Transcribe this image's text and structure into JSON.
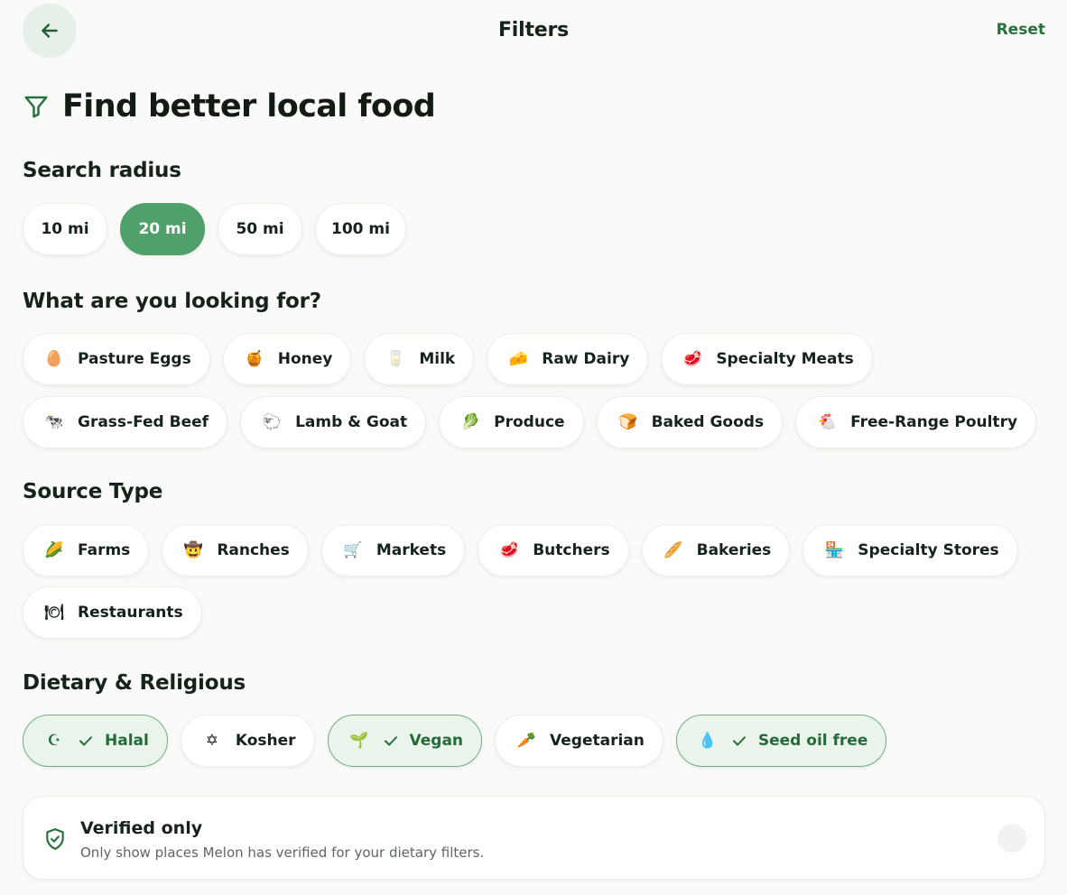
{
  "header": {
    "title": "Filters",
    "reset_label": "Reset"
  },
  "hero": {
    "title": "Find better local food"
  },
  "radius": {
    "title": "Search radius",
    "options": [
      "10 mi",
      "20 mi",
      "50 mi",
      "100 mi"
    ],
    "selected": "20 mi"
  },
  "looking": {
    "title": "What are you looking for?",
    "items": [
      {
        "emoji": "🥚",
        "label": "Pasture Eggs"
      },
      {
        "emoji": "🍯",
        "label": "Honey"
      },
      {
        "emoji": "🥛",
        "label": "Milk"
      },
      {
        "emoji": "🧀",
        "label": "Raw Dairy"
      },
      {
        "emoji": "🥩",
        "label": "Specialty Meats"
      },
      {
        "emoji": "🐄",
        "label": "Grass-Fed Beef"
      },
      {
        "emoji": "🐑",
        "label": "Lamb & Goat"
      },
      {
        "emoji": "🥬",
        "label": "Produce"
      },
      {
        "emoji": "🍞",
        "label": "Baked Goods"
      },
      {
        "emoji": "🐔",
        "label": "Free-Range Poultry"
      }
    ]
  },
  "source": {
    "title": "Source Type",
    "items": [
      {
        "emoji": "🌽",
        "label": "Farms"
      },
      {
        "emoji": "🤠",
        "label": "Ranches"
      },
      {
        "emoji": "🛒",
        "label": "Markets"
      },
      {
        "emoji": "🥩",
        "label": "Butchers"
      },
      {
        "emoji": "🥖",
        "label": "Bakeries"
      },
      {
        "emoji": "🏪",
        "label": "Specialty Stores"
      },
      {
        "emoji": "🍽",
        "label": "Restaurants"
      }
    ]
  },
  "dietary": {
    "title": "Dietary & Religious",
    "items": [
      {
        "emoji": "☪",
        "label": "Halal",
        "selected": true
      },
      {
        "emoji": "✡",
        "label": "Kosher",
        "selected": false
      },
      {
        "emoji": "🌱",
        "label": "Vegan",
        "selected": true
      },
      {
        "emoji": "🥕",
        "label": "Vegetarian",
        "selected": false
      },
      {
        "emoji": "💧",
        "label": "Seed oil free",
        "selected": true
      }
    ]
  },
  "verified": {
    "title": "Verified only",
    "description": "Only show places Melon has verified for your dietary filters.",
    "enabled": false
  },
  "colors": {
    "accent": "#4fa06a",
    "accent_dark": "#27703e",
    "selected_bg": "#eaf4ea",
    "background": "#fafbf8"
  }
}
